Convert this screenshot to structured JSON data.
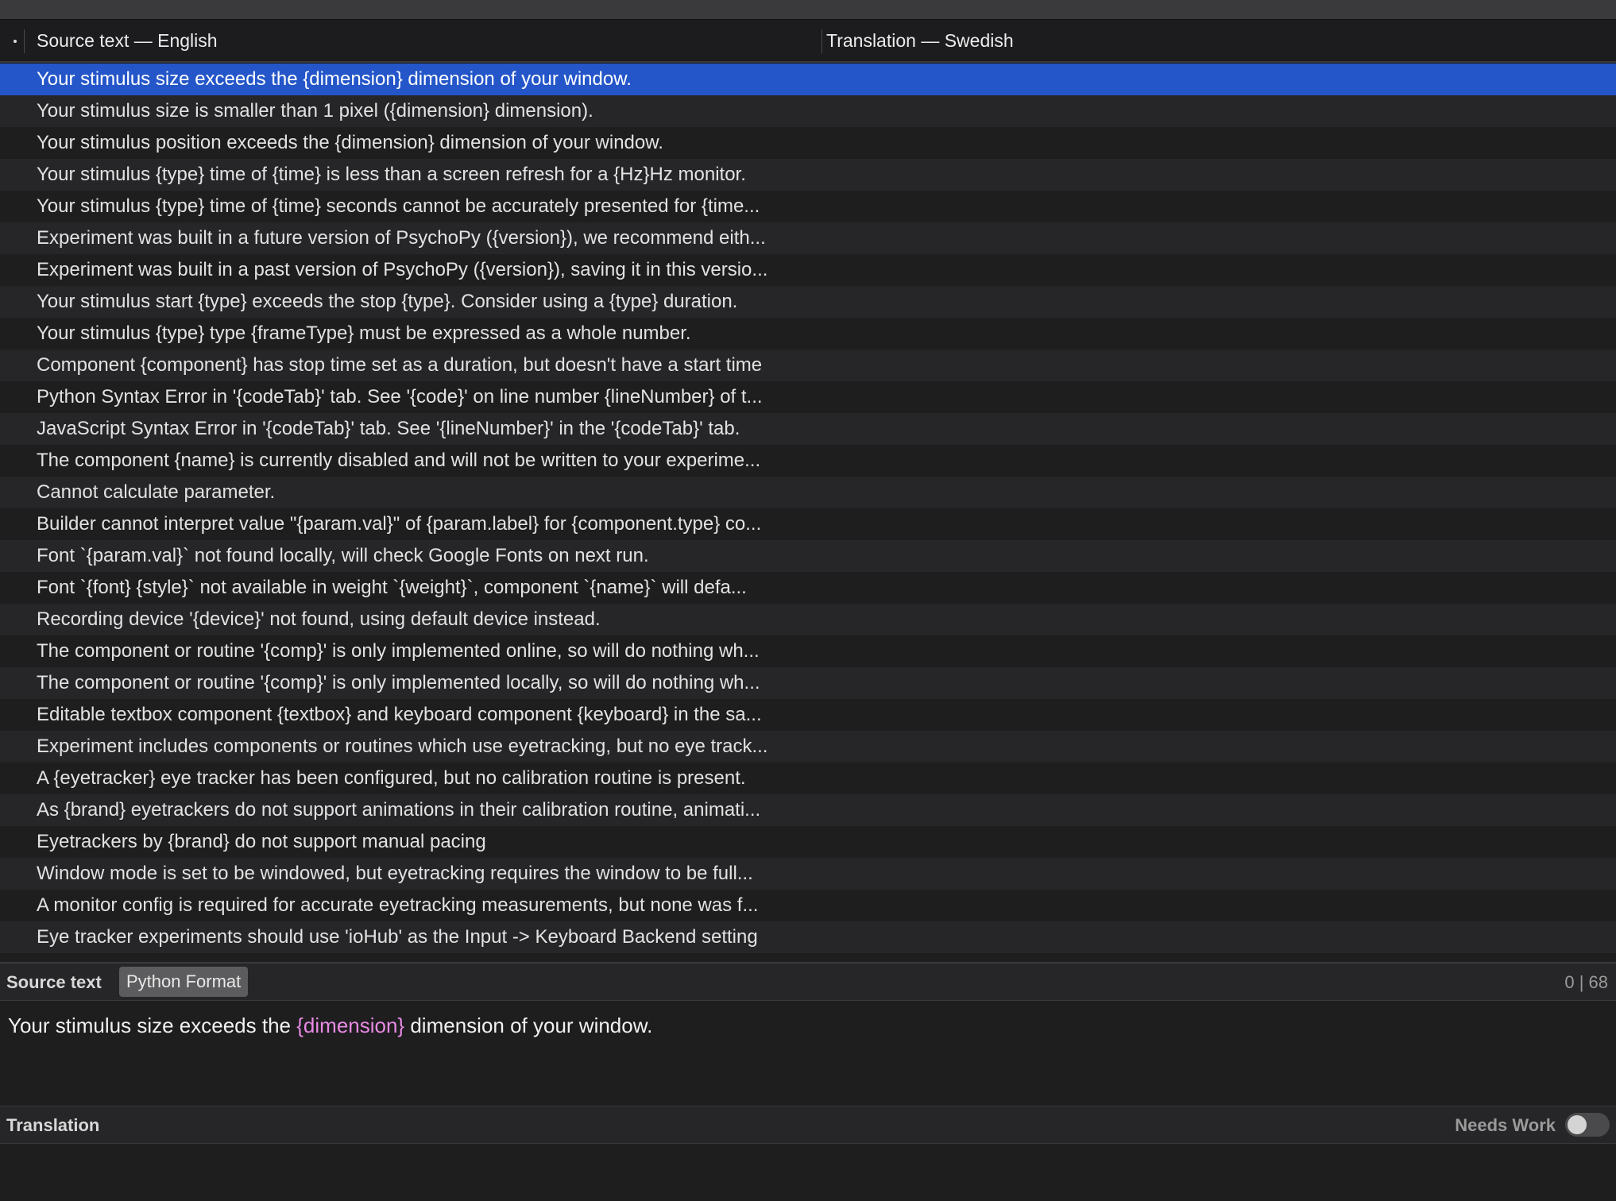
{
  "table": {
    "col_source_label": "Source text — English",
    "col_translation_label": "Translation — Swedish",
    "rows": [
      {
        "source": "Your stimulus size exceeds the {dimension} dimension of your window.",
        "translation": ""
      },
      {
        "source": "Your stimulus size is smaller than 1 pixel ({dimension} dimension).",
        "translation": ""
      },
      {
        "source": "Your stimulus position exceeds the {dimension} dimension of your window.",
        "translation": ""
      },
      {
        "source": "Your stimulus {type} time of {time} is less than a screen refresh for a {Hz}Hz monitor.",
        "translation": ""
      },
      {
        "source": "Your stimulus {type} time of {time} seconds cannot be accurately presented for {time...",
        "translation": ""
      },
      {
        "source": "Experiment was built in a future version of PsychoPy ({version}), we recommend eith...",
        "translation": ""
      },
      {
        "source": "Experiment was built in a past version of PsychoPy ({version}), saving it in this versio...",
        "translation": ""
      },
      {
        "source": "Your stimulus start {type} exceeds the stop {type}. Consider using a {type} duration.",
        "translation": ""
      },
      {
        "source": "Your stimulus {type} type {frameType} must be expressed as a whole number.",
        "translation": ""
      },
      {
        "source": "Component {component} has stop time set as a duration, but doesn't have a start time",
        "translation": ""
      },
      {
        "source": "Python Syntax Error in '{codeTab}' tab. See '{code}' on line number {lineNumber} of t...",
        "translation": ""
      },
      {
        "source": "JavaScript Syntax Error in '{codeTab}' tab. See '{lineNumber}' in the '{codeTab}' tab.",
        "translation": ""
      },
      {
        "source": "The component {name} is currently disabled and will not be written to your experime...",
        "translation": ""
      },
      {
        "source": "Cannot calculate parameter.",
        "translation": ""
      },
      {
        "source": "Builder cannot interpret value \"{param.val}\" of {param.label} for {component.type} co...",
        "translation": ""
      },
      {
        "source": "Font `{param.val}` not found locally, will check Google Fonts on next run.",
        "translation": ""
      },
      {
        "source": "Font `{font} {style}` not available in weight `{weight}`, component `{name}` will defa...",
        "translation": ""
      },
      {
        "source": "Recording device '{device}' not found, using default device instead.",
        "translation": ""
      },
      {
        "source": "The component or routine '{comp}' is only implemented online, so will do nothing wh...",
        "translation": ""
      },
      {
        "source": "The component or routine '{comp}' is only implemented locally, so will do nothing wh...",
        "translation": ""
      },
      {
        "source": "Editable textbox component {textbox} and keyboard component {keyboard} in the sa...",
        "translation": ""
      },
      {
        "source": "Experiment includes components or routines which use eyetracking, but no eye track...",
        "translation": ""
      },
      {
        "source": "A {eyetracker} eye tracker has been configured, but no calibration routine is present.",
        "translation": ""
      },
      {
        "source": "As {brand} eyetrackers do not support animations in their calibration routine, animati...",
        "translation": ""
      },
      {
        "source": "Eyetrackers by {brand} do not support manual pacing",
        "translation": ""
      },
      {
        "source": "Window mode is set to be windowed, but eyetracking requires the window to be full...",
        "translation": ""
      },
      {
        "source": "A monitor config is required for accurate eyetracking measurements, but none was f...",
        "translation": ""
      },
      {
        "source": "Eye tracker experiments should use 'ioHub' as the Input -> Keyboard Backend setting",
        "translation": ""
      }
    ],
    "selected_index": 0
  },
  "source_panel": {
    "title": "Source text",
    "format_badge": "Python Format",
    "char_count": "0 | 68",
    "text_before": "Your stimulus size exceeds the ",
    "text_placeholder": "{dimension}",
    "text_after": " dimension of your window."
  },
  "translation_panel": {
    "title": "Translation",
    "needs_work_label": "Needs Work",
    "needs_work_on": false,
    "value": ""
  },
  "colors": {
    "selection": "#2456c9",
    "placeholder": "#e98ae6",
    "background": "#1e1e1e",
    "alt_row": "#262628"
  }
}
